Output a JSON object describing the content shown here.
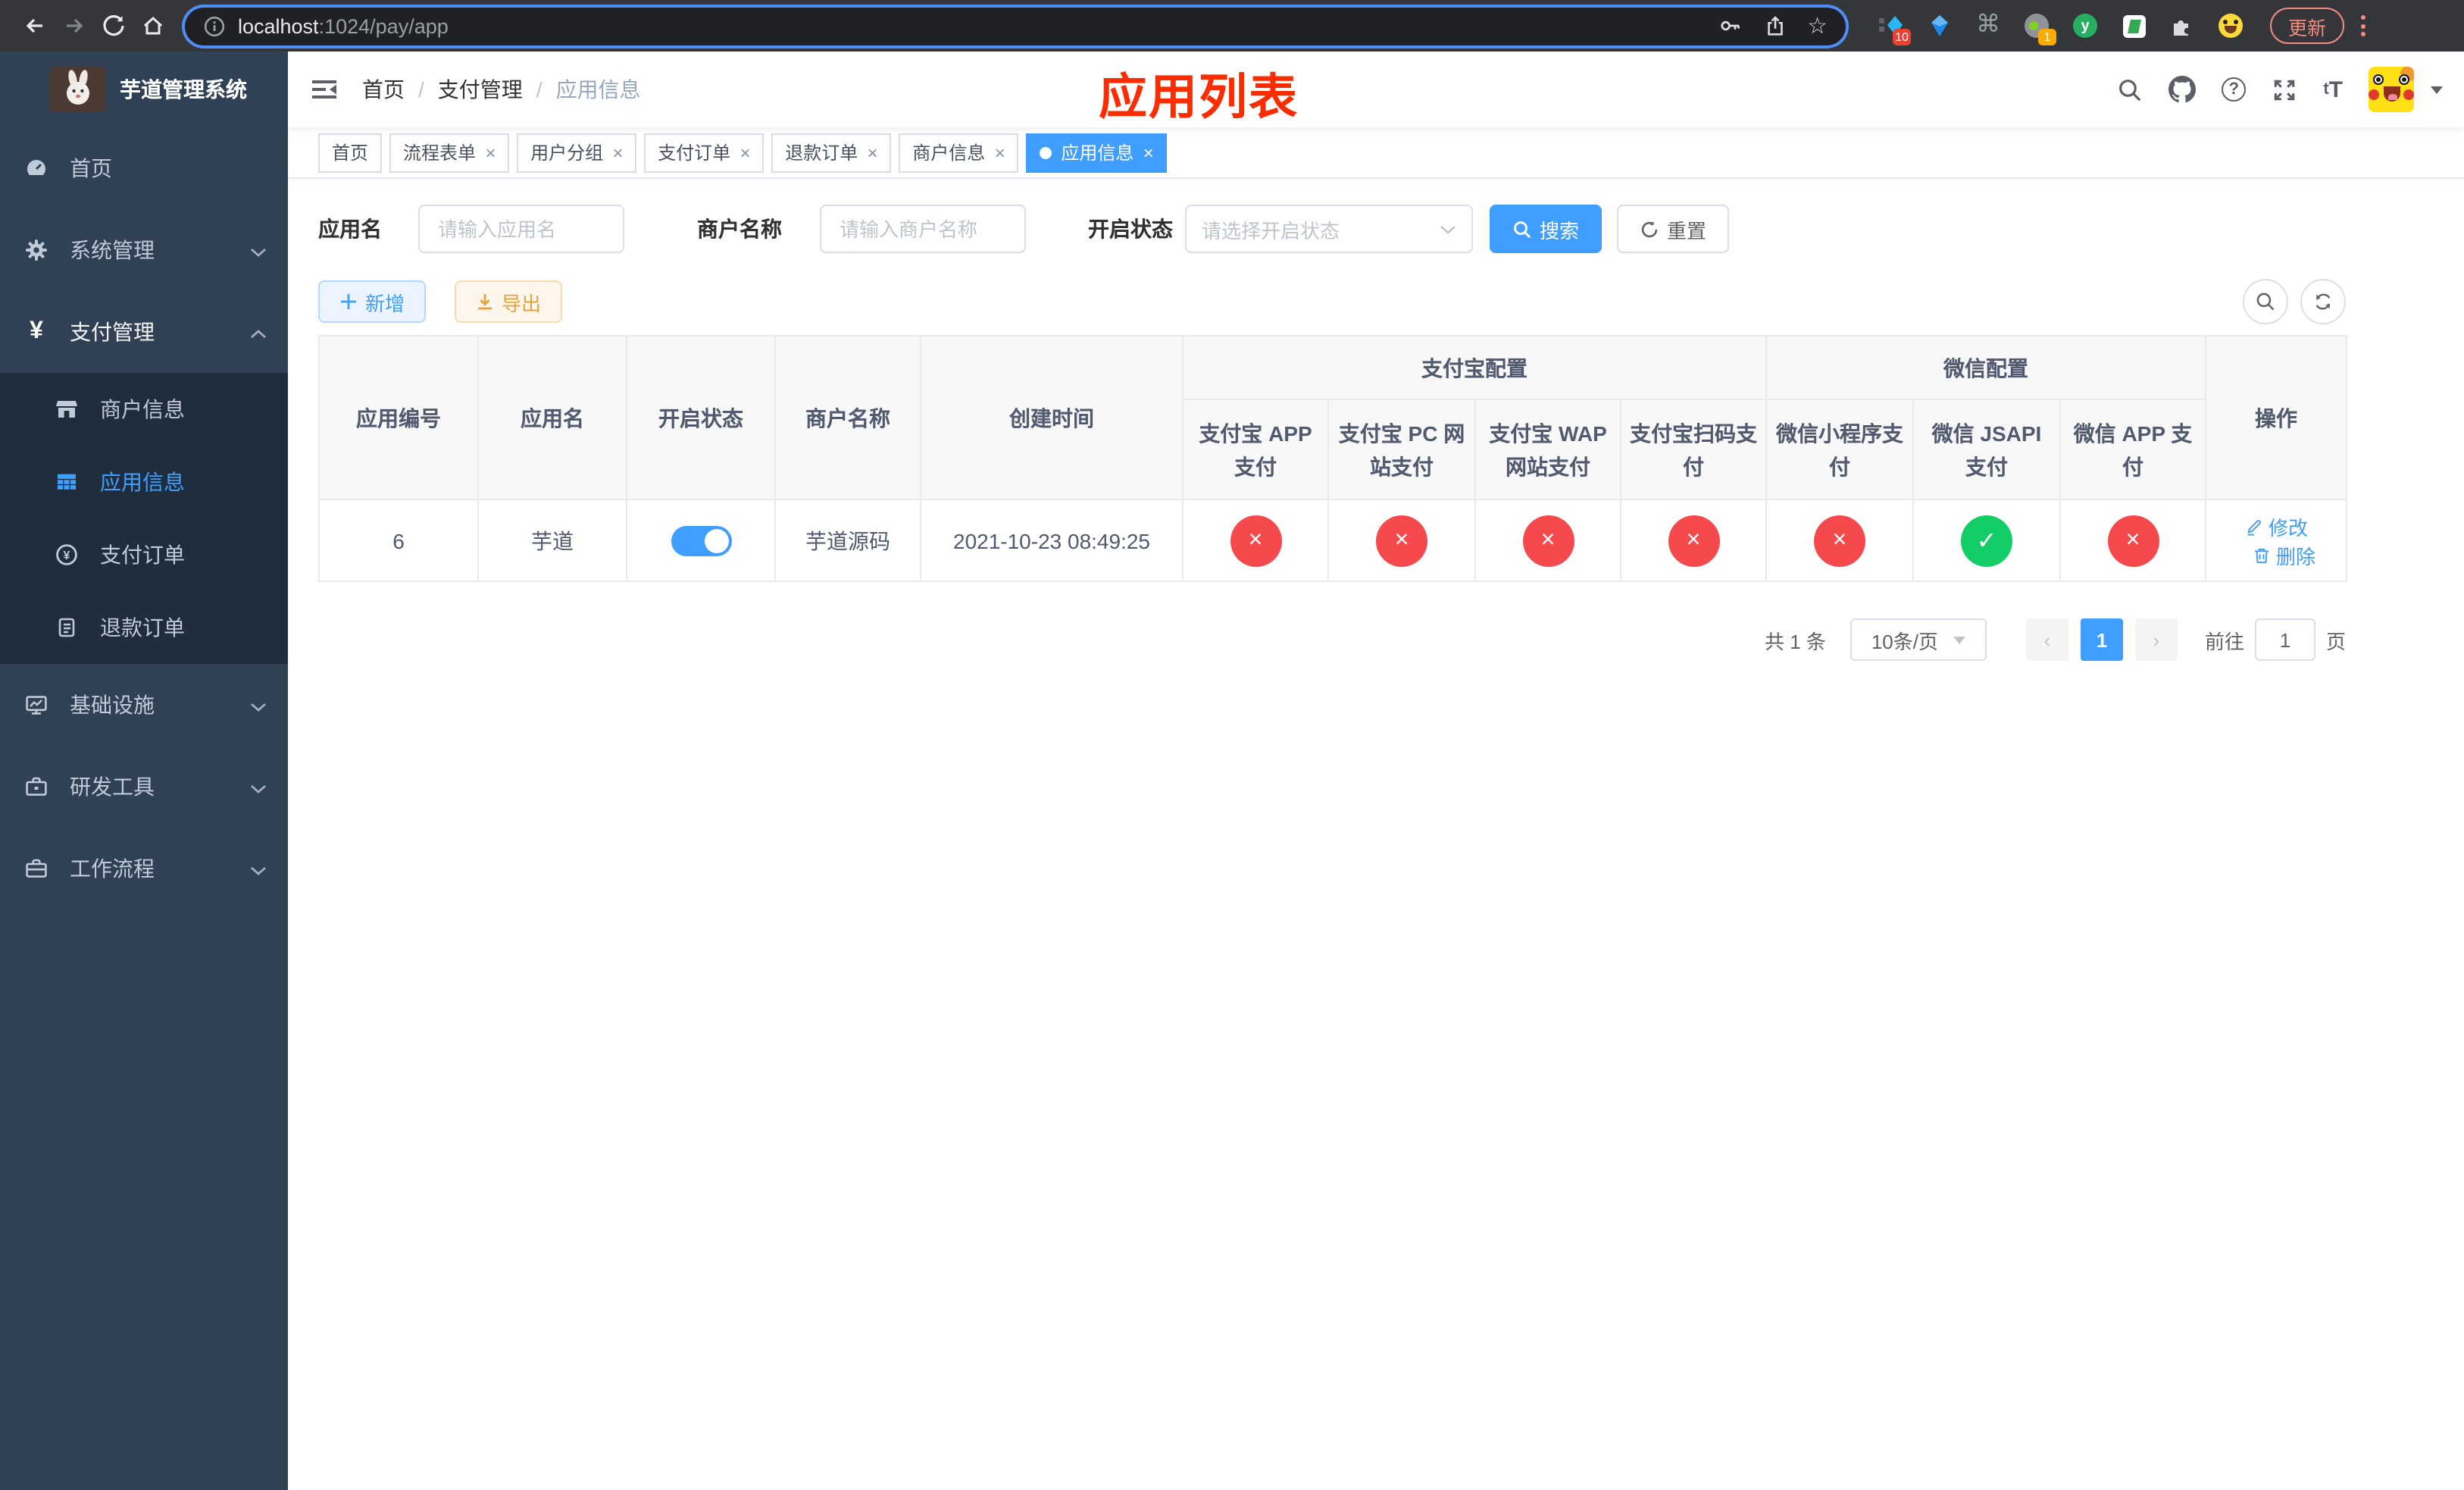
{
  "browser": {
    "url_host": "localhost",
    "url_rest": ":1024/pay/app",
    "update_label": "更新",
    "ext1_badge": "10",
    "ext4_badge": "1",
    "ext5_letter": "y"
  },
  "sidebar": {
    "title": "芋道管理系统",
    "home": "首页",
    "system": "系统管理",
    "pay": "支付管理",
    "merchant": "商户信息",
    "app": "应用信息",
    "pay_order": "支付订单",
    "refund_order": "退款订单",
    "infra": "基础设施",
    "dev_tools": "研发工具",
    "workflow": "工作流程"
  },
  "navbar": {
    "breadcrumb": {
      "home": "首页",
      "pay": "支付管理",
      "app": "应用信息"
    },
    "annotation": "应用列表",
    "font_icon": "tT"
  },
  "tabs": {
    "active_index": 6,
    "t0": "首页",
    "t1": "流程表单",
    "t2": "用户分组",
    "t3": "支付订单",
    "t4": "退款订单",
    "t5": "商户信息",
    "t6": "应用信息"
  },
  "filters": {
    "app_name_label": "应用名",
    "app_name_placeholder": "请输入应用名",
    "merchant_label": "商户名称",
    "merchant_placeholder": "请输入商户名称",
    "status_label": "开启状态",
    "status_placeholder": "请选择开启状态",
    "search_label": "搜索",
    "reset_label": "重置"
  },
  "toolbar": {
    "add_label": "新增",
    "export_label": "导出"
  },
  "table": {
    "h_id": "应用编号",
    "h_name": "应用名",
    "h_status": "开启状态",
    "h_merchant": "商户名称",
    "h_created": "创建时间",
    "h_alipay_group": "支付宝配置",
    "h_wechat_group": "微信配置",
    "h_alipay_app": "支付宝 APP 支付",
    "h_alipay_pc": "支付宝 PC 网站支付",
    "h_alipay_wap": "支付宝 WAP 网站支付",
    "h_alipay_qr": "支付宝扫码支付",
    "h_wx_mini": "微信小程序支付",
    "h_wx_jsapi": "微信 JSAPI 支付",
    "h_wx_app": "微信 APP 支付",
    "h_actions": "操作",
    "row": {
      "id": "6",
      "name": "芋道",
      "enabled": true,
      "merchant": "芋道源码",
      "created": "2021-10-23 08:49:25",
      "configs": [
        false,
        false,
        false,
        false,
        false,
        true,
        false
      ],
      "edit_label": "修改",
      "delete_label": "删除"
    }
  },
  "pagination": {
    "total": "共 1 条",
    "page_size": "10条/页",
    "page": "1",
    "goto_label": "前往",
    "goto_value": "1",
    "unit_label": "页"
  },
  "colors": {
    "accent": "#409eff",
    "danger": "#f5494d",
    "success": "#13ce66",
    "annotation": "#fa2c00",
    "sidebar_bg": "#304156",
    "submenu_bg": "#1f2d3d"
  }
}
